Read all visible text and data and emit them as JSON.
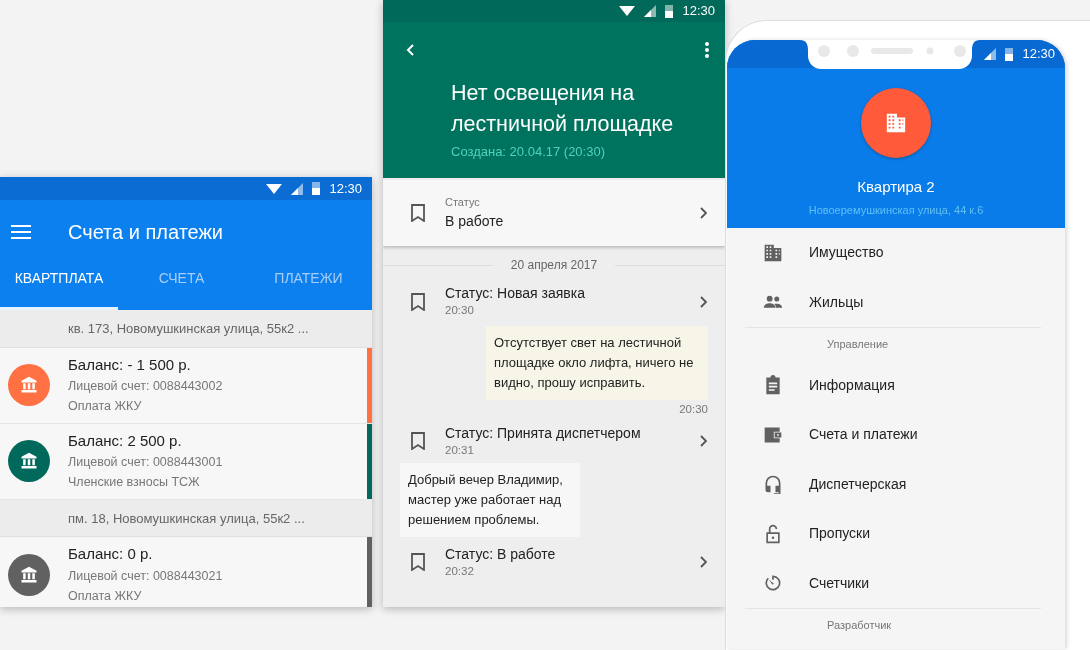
{
  "bills_screen": {
    "status_time": "12:30",
    "title": "Счета и платежи",
    "tabs": [
      {
        "label": "КВАРТПЛАТА",
        "selected": true
      },
      {
        "label": "СЧЕТА",
        "selected": false
      },
      {
        "label": "ПЛАТЕЖИ",
        "selected": false
      }
    ],
    "groups": [
      {
        "address": "кв. 173, Новомушкинская улица, 55к2 ...",
        "accounts": [
          {
            "balance": "Баланс: - 1 500 р.",
            "account": "Лицевой счет: 0088443002",
            "purpose": "Оплата ЖКУ",
            "color": "#ff7043"
          },
          {
            "balance": "Баланс: 2 500 р.",
            "account": "Лицевой счет: 0088443001",
            "purpose": "Членские взносы ТСЖ",
            "color": "#00695c"
          }
        ]
      },
      {
        "address": "пм. 18, Новомушкинская улица, 55к2 ...",
        "accounts": [
          {
            "balance": "Баланс: 0 р.",
            "account": "Лицевой счет: 0088443021",
            "purpose": "Оплата ЖКУ",
            "color": "#616161"
          }
        ]
      }
    ]
  },
  "request_screen": {
    "status_time": "12:30",
    "title": "Нет освещения на лестничной площадке",
    "created": "Создана: 20.04.17 (20:30)",
    "status": {
      "label": "Статус",
      "value": "В работе"
    },
    "date_divider": "20 апреля 2017",
    "events": [
      {
        "kind": "status",
        "text": "Статус: Новая заявка",
        "time": "20:30"
      },
      {
        "kind": "sent",
        "text": "Отсутствует свет на лестичной площадке окло лифта, ничего не видно, прошу исправить.",
        "time": "20:30"
      },
      {
        "kind": "status",
        "text": "Статус: Принята диспетчером",
        "time": "20:31"
      },
      {
        "kind": "received",
        "text": "Добрый вечер Владимир, мастер уже работает над решением проблемы."
      },
      {
        "kind": "status",
        "text": "Статус: В работе",
        "time": "20:32"
      }
    ]
  },
  "menu_screen": {
    "status_time": "12:30",
    "title": "Квартира 2",
    "address": "Новоеремушкинская улица, 44 к.6",
    "sections": [
      {
        "items": [
          {
            "kind": "building",
            "label": "Имущество"
          },
          {
            "kind": "people",
            "label": "Жильцы"
          }
        ]
      },
      {
        "header": "Управление",
        "items": [
          {
            "kind": "clipboard",
            "label": "Информация"
          },
          {
            "kind": "wallet",
            "label": "Счета и платежи"
          },
          {
            "kind": "headset",
            "label": "Диспетчерская"
          },
          {
            "kind": "lock",
            "label": "Пропуски"
          },
          {
            "kind": "timer",
            "label": "Счетчики"
          }
        ]
      },
      {
        "header": "Разработчик"
      }
    ]
  }
}
